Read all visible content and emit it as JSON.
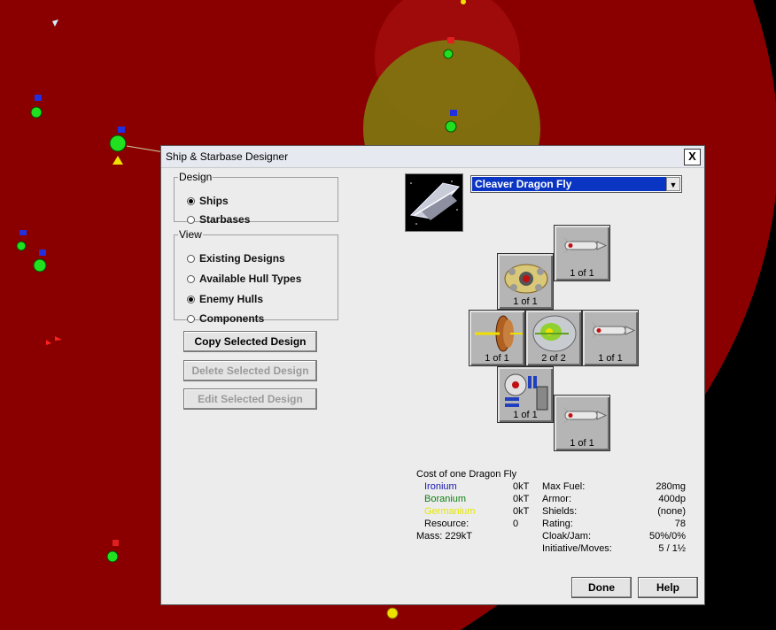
{
  "window": {
    "title": "Ship & Starbase Designer",
    "close_label": "X"
  },
  "design_group": {
    "legend": "Design",
    "options": [
      "Ships",
      "Starbases"
    ],
    "selected": "Ships"
  },
  "view_group": {
    "legend": "View",
    "options": [
      "Existing Designs",
      "Available Hull Types",
      "Enemy Hulls",
      "Components"
    ],
    "selected": "Enemy Hulls"
  },
  "buttons": {
    "copy": "Copy Selected Design",
    "delete": "Delete Selected Design",
    "edit": "Edit Selected Design",
    "done": "Done",
    "help": "Help"
  },
  "design_select": {
    "value": "Cleaver Dragon Fly"
  },
  "slots": [
    {
      "id": "top-missile",
      "icon": "missile-icon",
      "count": "1 of 1"
    },
    {
      "id": "engine",
      "icon": "engine-icon",
      "count": "1 of 1"
    },
    {
      "id": "left-thruster",
      "icon": "thruster-icon",
      "count": "1 of 1"
    },
    {
      "id": "center-scanner",
      "icon": "scanner-orb-icon",
      "count": "2 of 2"
    },
    {
      "id": "mid-missile",
      "icon": "missile-icon",
      "count": "1 of 1"
    },
    {
      "id": "bottom-device",
      "icon": "computer-icon",
      "count": "1 of 1"
    },
    {
      "id": "bottom-missile",
      "icon": "missile-icon",
      "count": "1 of 1"
    }
  ],
  "cost": {
    "title": "Cost of one Dragon Fly",
    "minerals": [
      {
        "name": "Ironium",
        "value": "0kT",
        "color": "#1818b0"
      },
      {
        "name": "Boranium",
        "value": "0kT",
        "color": "#108010"
      },
      {
        "name": "Germanium",
        "value": "0kT",
        "color": "#e6e600"
      }
    ],
    "resource_label": "Resource:",
    "resource_value": "0",
    "mass": "Mass: 229kT"
  },
  "stats": [
    {
      "label": "Max Fuel:",
      "value": "280mg"
    },
    {
      "label": "Armor:",
      "value": "400dp"
    },
    {
      "label": "Shields:",
      "value": "(none)"
    },
    {
      "label": "Rating:",
      "value": "78"
    },
    {
      "label": "Cloak/Jam:",
      "value": "50%/0%"
    },
    {
      "label": "Initiative/Moves:",
      "value": "5 / 1½"
    }
  ]
}
